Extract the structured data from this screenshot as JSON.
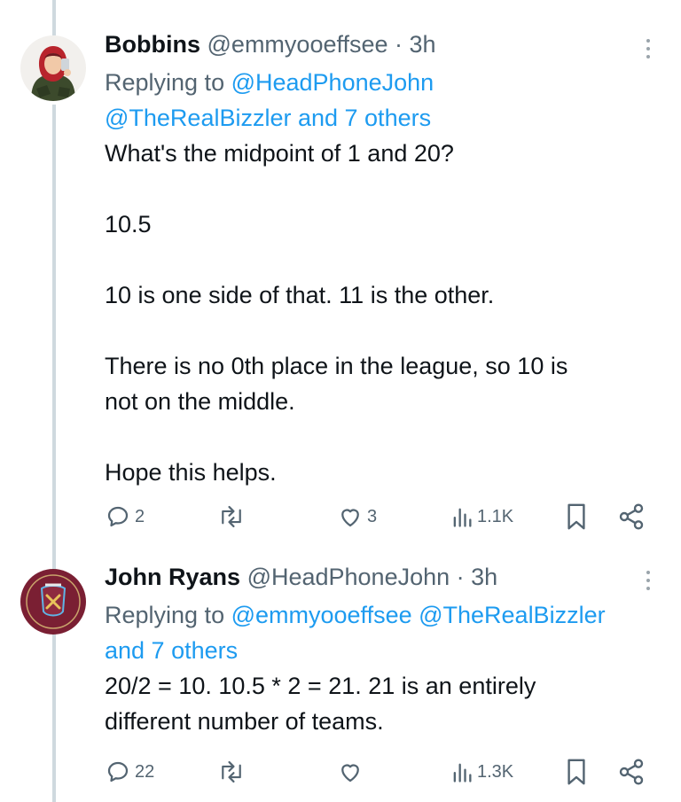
{
  "tweets": [
    {
      "name": "Bobbins",
      "handle": "@emmyooeffsee",
      "time": " · 3h",
      "reply_prefix": "Replying to ",
      "reply_line1": "@HeadPhoneJohn",
      "reply_line2": "@TheRealBizzler and 7 others",
      "body": [
        "What's the midpoint of 1 and 20?",
        "10.5",
        "10 is one side of that. 11 is the other.",
        "There is no 0th place in the league, so 10 is",
        "not on the middle.",
        "Hope this helps."
      ],
      "actions": {
        "replies": "2",
        "retweets": "",
        "likes": "3",
        "views": "1.1K"
      },
      "avatar_icon": "user-avatar-bobbins"
    },
    {
      "name": "John Ryans",
      "handle": "@HeadPhoneJohn",
      "time": " · 3h",
      "reply_prefix": "Replying to ",
      "reply_line1": "@emmyooeffsee @TheRealBizzler",
      "reply_line2": "and 7 others",
      "body": [
        "20/2 = 10. 10.5 * 2 = 21. 21 is an entirely",
        "different number of teams."
      ],
      "actions": {
        "replies": "22",
        "retweets": "",
        "likes": "",
        "views": "1.3K"
      },
      "avatar_icon": "west-ham-crest-avatar"
    }
  ],
  "icons": [
    "reply-icon",
    "retweet-icon",
    "like-icon",
    "views-icon",
    "bookmark-icon",
    "share-icon",
    "more-icon"
  ],
  "colors": {
    "link": "#1d9bf0",
    "meta": "#536471",
    "text": "#0f1419",
    "thread_line": "#cfd9de"
  }
}
